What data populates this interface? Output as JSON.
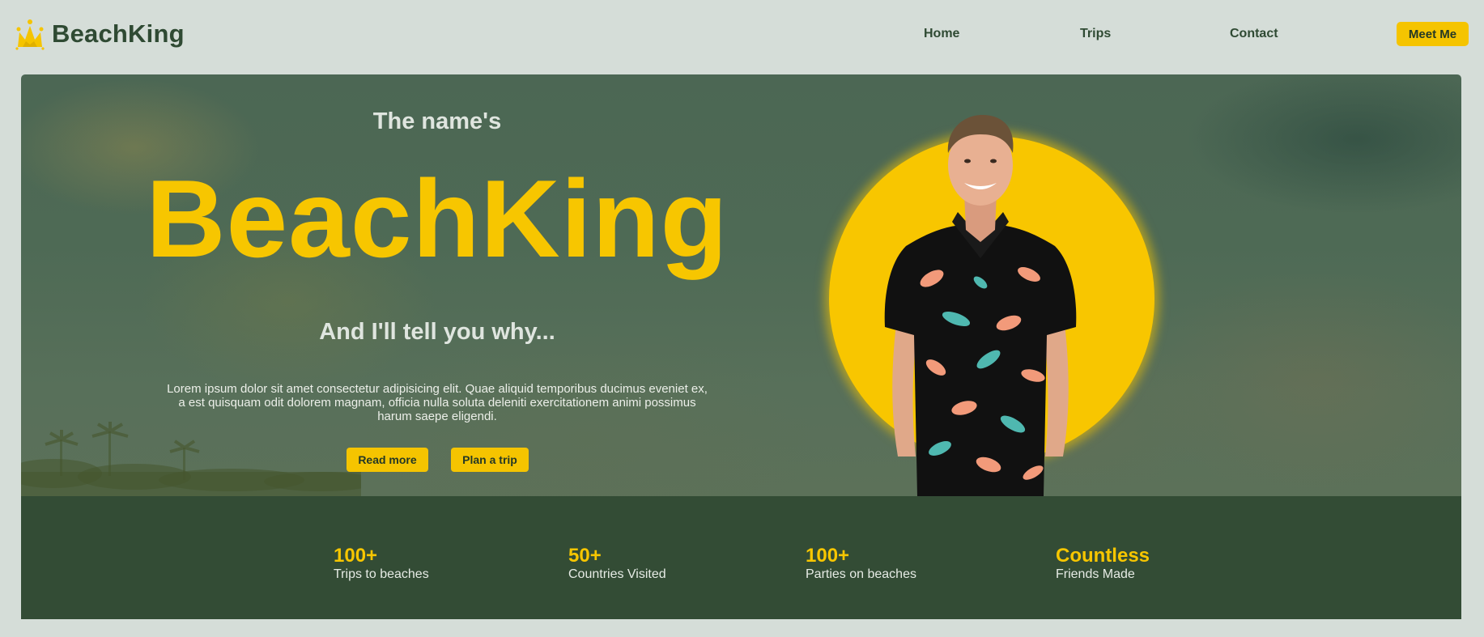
{
  "navbar": {
    "brand": "BeachKing",
    "links": [
      "Home",
      "Trips",
      "Contact"
    ],
    "cta": "Meet Me"
  },
  "hero": {
    "intro": "The name's",
    "title": "BeachKing",
    "tagline": "And I'll tell you why...",
    "paragraph": "Lorem ipsum dolor sit amet consectetur adipisicing elit. Quae aliquid temporibus ducimus eveniet ex, a est quisquam odit dolorem magnam, officia nulla soluta deleniti exercitationem animi possimus harum saepe eligendi.",
    "buttons": [
      "Read more",
      "Plan a trip"
    ]
  },
  "stats": [
    {
      "value": "100+",
      "label": "Trips to beaches"
    },
    {
      "value": "50+",
      "label": "Countries Visited"
    },
    {
      "value": "100+",
      "label": "Parties on beaches"
    },
    {
      "value": "Countless",
      "label": "Friends Made"
    }
  ],
  "colors": {
    "accent": "#f7c600",
    "dark_green": "#334c35",
    "background": "#d5ddd8"
  },
  "icons": {
    "brand": "crown-icon"
  }
}
